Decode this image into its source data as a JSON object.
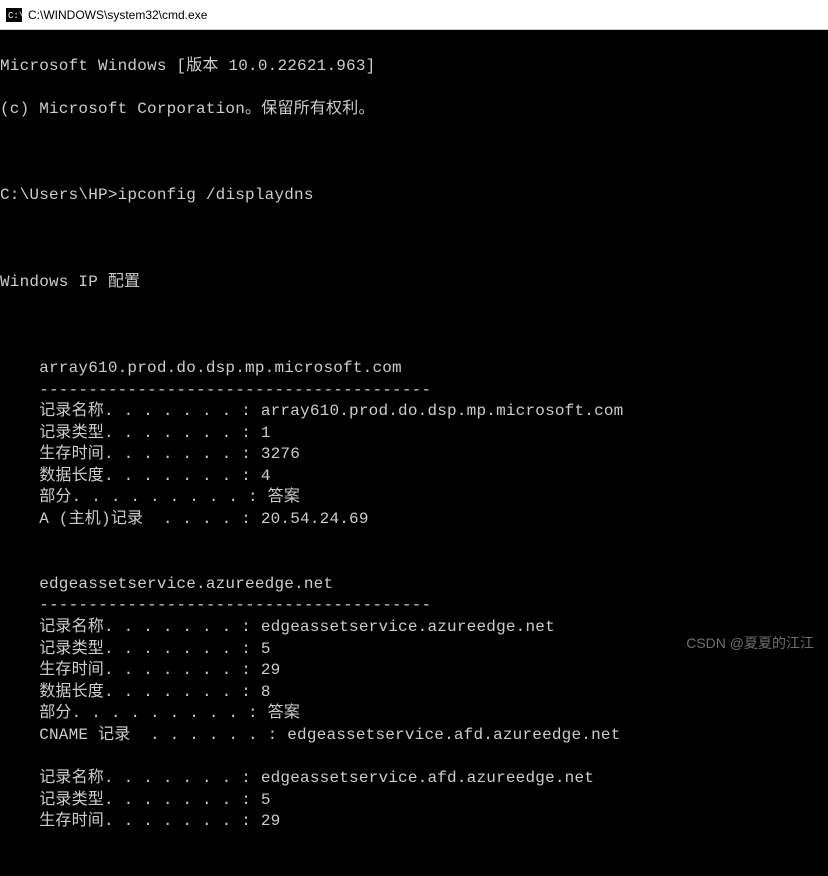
{
  "titlebar": {
    "text": "C:\\WINDOWS\\system32\\cmd.exe"
  },
  "header": {
    "line1": "Microsoft Windows [版本 10.0.22621.963]",
    "line2": "(c) Microsoft Corporation。保留所有权利。"
  },
  "prompt": {
    "path": "C:\\Users\\HP>",
    "command": "ipconfig /displaydns"
  },
  "section_title": "Windows IP 配置",
  "entries": [
    {
      "hostname": "array610.prod.do.dsp.mp.microsoft.com",
      "separator": "----------------------------------------",
      "rows": [
        {
          "label": "记录名称",
          "dots": ". . . . . . .",
          "value": "array610.prod.do.dsp.mp.microsoft.com"
        },
        {
          "label": "记录类型",
          "dots": ". . . . . . .",
          "value": "1"
        },
        {
          "label": "生存时间",
          "dots": ". . . . . . .",
          "value": "3276"
        },
        {
          "label": "数据长度",
          "dots": ". . . . . . .",
          "value": "4"
        },
        {
          "label": "部分",
          "dots": ". . . . . . . . .",
          "value": "答案"
        },
        {
          "label": "A (主机)记录",
          "dots": "  . . . .",
          "value": "20.54.24.69"
        }
      ]
    },
    {
      "hostname": "edgeassetservice.azureedge.net",
      "separator": "----------------------------------------",
      "rows": [
        {
          "label": "记录名称",
          "dots": ". . . . . . .",
          "value": "edgeassetservice.azureedge.net"
        },
        {
          "label": "记录类型",
          "dots": ". . . . . . .",
          "value": "5"
        },
        {
          "label": "生存时间",
          "dots": ". . . . . . .",
          "value": "29"
        },
        {
          "label": "数据长度",
          "dots": ". . . . . . .",
          "value": "8"
        },
        {
          "label": "部分",
          "dots": ". . . . . . . . .",
          "value": "答案"
        },
        {
          "label": "CNAME 记录",
          "dots": "  . . . . . .",
          "value": "edgeassetservice.afd.azureedge.net"
        }
      ]
    },
    {
      "hostname": "",
      "separator": "",
      "rows": [
        {
          "label": "记录名称",
          "dots": ". . . . . . .",
          "value": "edgeassetservice.afd.azureedge.net"
        },
        {
          "label": "记录类型",
          "dots": ". . . . . . .",
          "value": "5"
        },
        {
          "label": "生存时间",
          "dots": ". . . . . . .",
          "value": "29"
        }
      ]
    }
  ],
  "watermark": "CSDN @夏夏的江江"
}
